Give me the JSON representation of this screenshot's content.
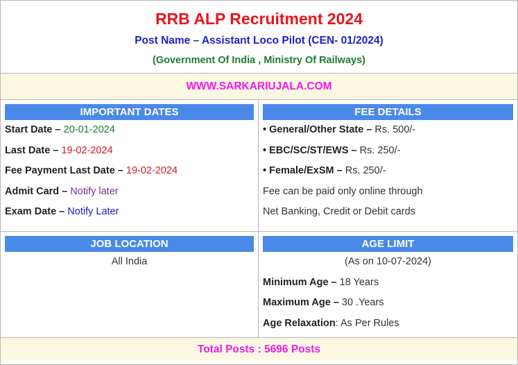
{
  "header": {
    "title": "RRB ALP Recruitment 2024",
    "post_name": "Post Name – Assistant Loco Pilot (CEN- 01/2024)",
    "ministry": "(Government Of India , Ministry Of Railways)"
  },
  "website": "WWW.SARKARIUJALA.COM",
  "important_dates": {
    "heading": "IMPORTANT DATES",
    "items": [
      {
        "label": "Start Date –",
        "value": "20-01-2024"
      },
      {
        "label": "Last Date –",
        "value": "19-02-2024"
      },
      {
        "label": "Fee Payment Last Date –",
        "value": "19-02-2024"
      },
      {
        "label": "Admit Card –",
        "value": "Notify later"
      },
      {
        "label": "Exam Date –",
        "value": "Notify Later"
      }
    ]
  },
  "fee_details": {
    "heading": "FEE DETAILS",
    "items": [
      {
        "label": "• General/Other State –",
        "value": "Rs. 500/-"
      },
      {
        "label": "• EBC/SC/ST/EWS –",
        "value": "Rs. 250/-"
      },
      {
        "label": "• Female/ExSM –",
        "value": "Rs. 250/-"
      }
    ],
    "note_line1": "Fee can be paid only online through",
    "note_line2": "Net Banking, Credit or Debit cards"
  },
  "job_location": {
    "heading": "JOB LOCATION",
    "value": "All India"
  },
  "age_limit": {
    "heading": "AGE LIMIT",
    "as_on": "(As on 10-07-2024)",
    "items": [
      {
        "label": "Minimum Age –",
        "value": "18 Years"
      },
      {
        "label": "Maximum Age –",
        "value": "30 .Years"
      },
      {
        "label": "Age Relaxation",
        "value": ": As Per Rules"
      }
    ]
  },
  "total_posts": "Total Posts : 5696 Posts",
  "colors": {
    "title_red": "#e8141c",
    "post_blue": "#2020c8",
    "ministry_green": "#1e7b2e",
    "accent_magenta": "#f218f0",
    "header_blue": "#4a89e8",
    "band_cream": "#fdf8e2"
  }
}
